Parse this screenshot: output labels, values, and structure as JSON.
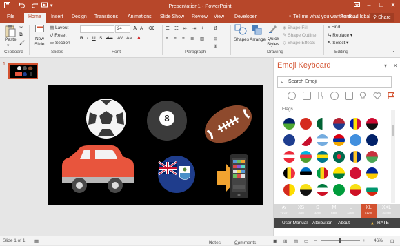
{
  "window": {
    "title": "Presentation1 - PowerPoint"
  },
  "quick_access": {
    "save_icon": "save-icon",
    "undo_icon": "undo-icon",
    "redo_icon": "redo-icon",
    "start_icon": "start-from-beginning-icon",
    "customize_icon": "chevron-down-icon"
  },
  "tabs": [
    "File",
    "Home",
    "Insert",
    "Design",
    "Transitions",
    "Animations",
    "Slide Show",
    "Review",
    "View",
    "Developer"
  ],
  "active_tab": "Home",
  "tell_me": "Tell me what you want to do...",
  "user_name": "Farshad Iqbal",
  "share_label": "Share",
  "ribbon": {
    "clipboard": {
      "label": "Clipboard",
      "paste": "Paste"
    },
    "slides": {
      "label": "Slides",
      "new_slide_1": "New",
      "new_slide_2": "Slide",
      "layout": "Layout",
      "reset": "Reset",
      "section": "Section"
    },
    "font": {
      "label": "Font",
      "size": "24"
    },
    "paragraph": {
      "label": "Paragraph"
    },
    "drawing": {
      "label": "Drawing",
      "shapes": "Shapes",
      "arrange": "Arrange",
      "quick_1": "Quick",
      "quick_2": "Styles",
      "shape_fill": "Shape Fill",
      "shape_outline": "Shape Outline",
      "shape_effects": "Shape Effects"
    },
    "editing": {
      "label": "Editing",
      "find": "Find",
      "replace": "Replace",
      "select": "Select"
    }
  },
  "thumbnails": {
    "slide_number": "1"
  },
  "panel": {
    "title": "Emoji Keyboard",
    "search_placeholder": "Search Emoji",
    "category": "Flags",
    "sizes": [
      {
        "label": "XS",
        "px": "16px"
      },
      {
        "label": "S",
        "px": "32px"
      },
      {
        "label": "M",
        "px": "64px"
      },
      {
        "label": "L",
        "px": "128px"
      },
      {
        "label": "XL",
        "px": "512px"
      },
      {
        "label": "XXL",
        "px": "1024px"
      }
    ],
    "text_label": "TEXT",
    "selected_size": "XL",
    "footer": {
      "user_manual": "User Manual",
      "attribution": "Attribution",
      "about": "About",
      "rate": "RATE"
    }
  },
  "slide_emojis": [
    "soccer-ball",
    "8-ball",
    "american-football",
    "car",
    "falkland-islands-flag",
    "mobile-phone-with-arrow"
  ],
  "status": {
    "slide_info": "Slide 1 of 1",
    "notes": "Notes",
    "comments": "Comments",
    "zoom": "46%"
  },
  "colors": {
    "accent": "#b7472a",
    "panel_accent": "#d35230"
  }
}
